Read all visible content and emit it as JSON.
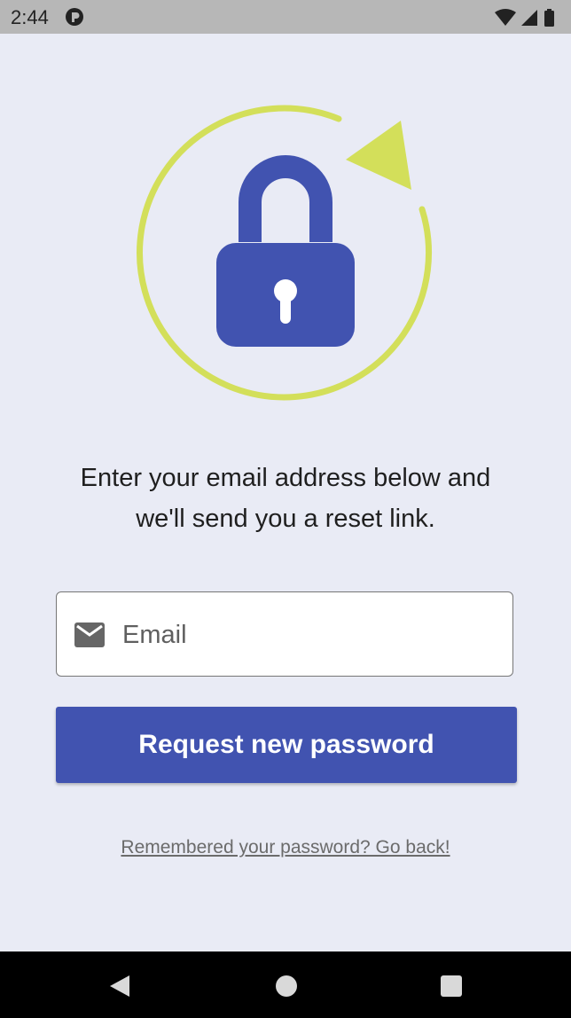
{
  "status_bar": {
    "time": "2:44",
    "app_icon": "app-notification-icon",
    "icons": [
      "wifi-icon",
      "signal-icon",
      "battery-icon"
    ]
  },
  "illustration": {
    "icon": "lock-reset-icon",
    "colors": {
      "lock": "#4153b0",
      "arrow": "#d3df5a"
    }
  },
  "instruction": {
    "line1": "Enter your email address below and",
    "line2": "we'll send you a reset link."
  },
  "email_field": {
    "icon": "mail-icon",
    "placeholder": "Email",
    "value": ""
  },
  "request_button": {
    "label": "Request new password",
    "color": "#4153b0"
  },
  "go_back_link": {
    "label": "Remembered your password? Go back!"
  },
  "nav_bar": {
    "back": "back-icon",
    "home": "home-icon",
    "recents": "recents-icon"
  }
}
